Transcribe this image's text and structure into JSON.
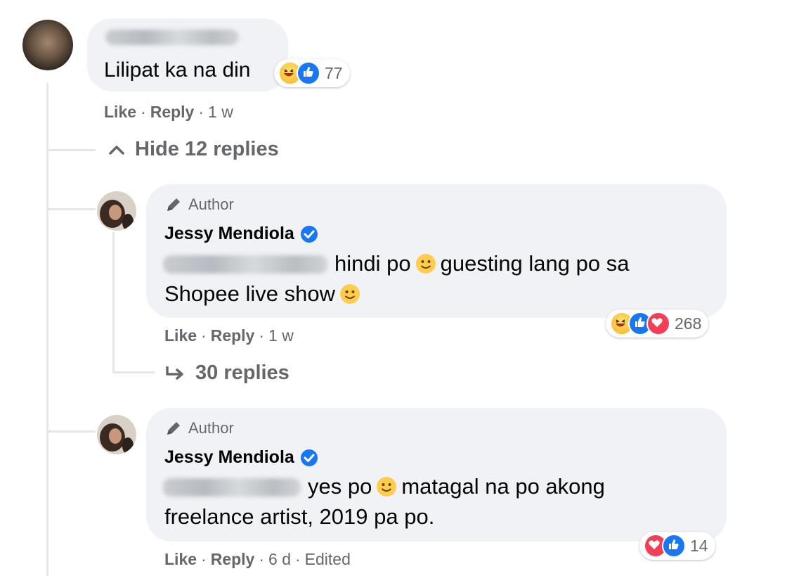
{
  "comment1": {
    "text": "Lilipat ka na din",
    "reaction_count": "77",
    "reactions": [
      "haha-icon",
      "like-icon"
    ],
    "meta": {
      "like": "Like",
      "reply": "Reply",
      "time": "1 w"
    },
    "hide_replies": "Hide 12 replies"
  },
  "reply1": {
    "badge": "Author",
    "name": "Jessy Mendiola",
    "text_line1": "hindi po",
    "text_line1b": "guesting lang po sa",
    "text_line2": "Shopee live show",
    "reaction_count": "268",
    "reactions": [
      "haha-icon",
      "like-icon",
      "love-icon"
    ],
    "meta": {
      "like": "Like",
      "reply": "Reply",
      "time": "1 w"
    },
    "more_replies": "30 replies"
  },
  "reply2": {
    "badge": "Author",
    "name": "Jessy Mendiola",
    "text_line1": "yes po",
    "text_line1b": "matagal na po akong",
    "text_line2": "freelance artist, 2019 pa po.",
    "reaction_count": "14",
    "reactions": [
      "love-icon",
      "like-icon"
    ],
    "meta": {
      "like": "Like",
      "reply": "Reply",
      "time": "6 d",
      "edited": "Edited"
    }
  },
  "colors": {
    "bubble": "#f0f2f5",
    "meta_text": "#65676b",
    "like_blue": "#1877f2",
    "love_red": "#f33e58",
    "verified_blue": "#1877f2"
  }
}
